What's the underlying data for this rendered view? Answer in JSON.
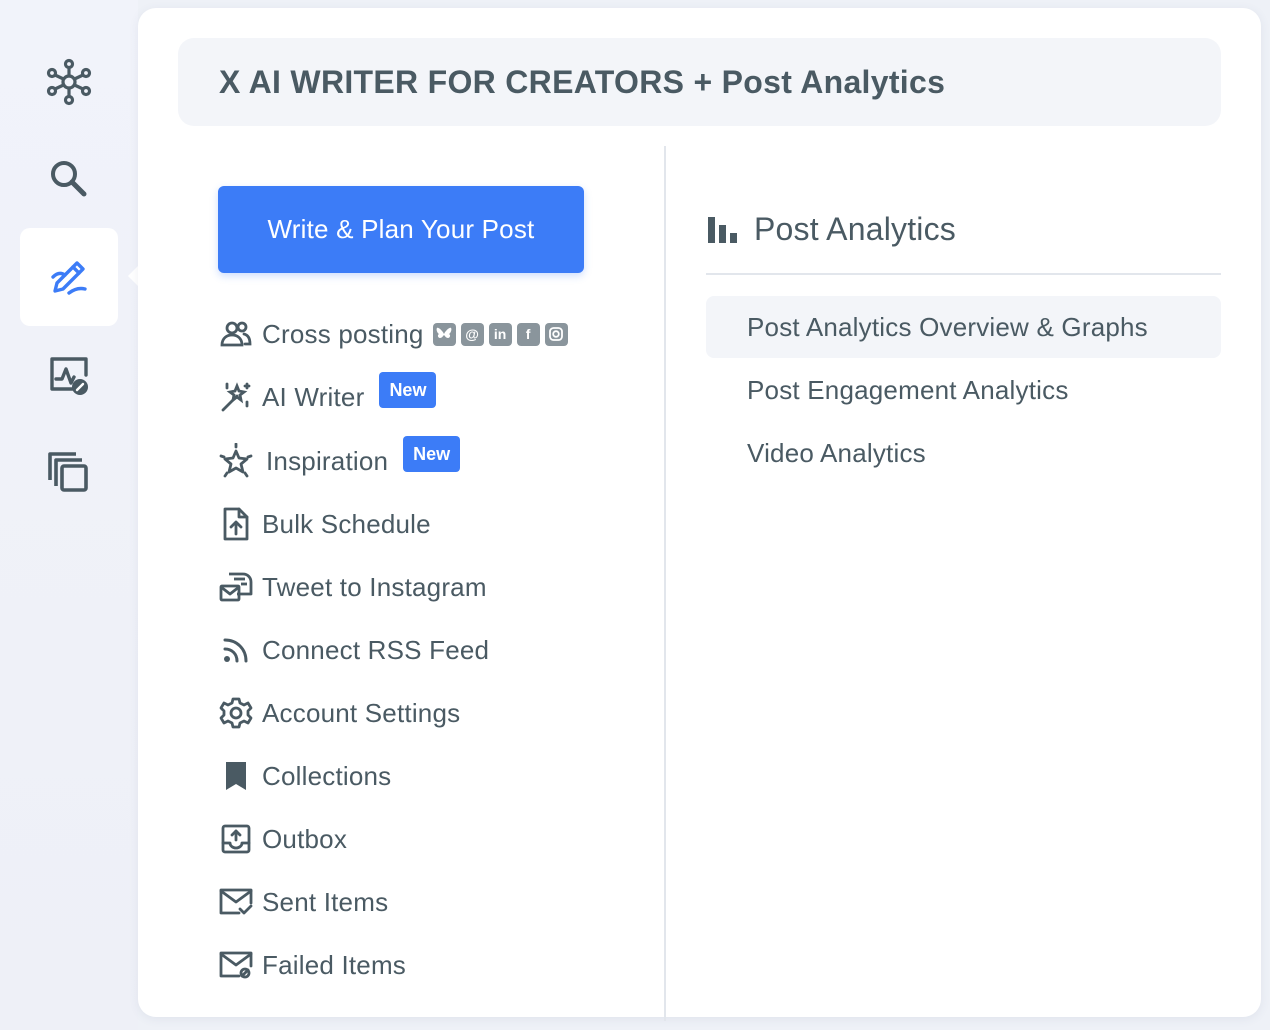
{
  "rail": {
    "items": [
      {
        "icon": "hub-network-icon",
        "active": false
      },
      {
        "icon": "search-icon",
        "active": false
      },
      {
        "icon": "write-edit-icon",
        "active": true
      },
      {
        "icon": "analytics-check-icon",
        "active": false
      },
      {
        "icon": "copy-stack-icon",
        "active": false
      }
    ]
  },
  "panel": {
    "title": "X AI WRITER FOR CREATORS + Post Analytics"
  },
  "left": {
    "cta_label": "Write & Plan Your Post",
    "items": [
      {
        "label": "Cross posting",
        "icon": "users-icon"
      },
      {
        "label": "AI Writer",
        "icon": "magic-wand-icon",
        "badge": "New"
      },
      {
        "label": "Inspiration",
        "icon": "sparkle-star-icon",
        "badge": "New"
      },
      {
        "label": "Bulk Schedule",
        "icon": "file-upload-icon"
      },
      {
        "label": "Tweet to Instagram",
        "icon": "mailbox-icon"
      },
      {
        "label": "Connect RSS Feed",
        "icon": "rss-icon"
      },
      {
        "label": "Account Settings",
        "icon": "gear-icon"
      },
      {
        "label": "Collections",
        "icon": "bookmark-icon"
      },
      {
        "label": "Outbox",
        "icon": "outbox-icon"
      },
      {
        "label": "Sent Items",
        "icon": "mail-check-icon"
      },
      {
        "label": "Failed Items",
        "icon": "mail-failed-icon"
      }
    ],
    "socials": [
      {
        "name": "bluesky-icon",
        "glyph": "🦋"
      },
      {
        "name": "threads-icon",
        "glyph": "@"
      },
      {
        "name": "linkedin-icon",
        "glyph": "in"
      },
      {
        "name": "facebook-icon",
        "glyph": "f"
      },
      {
        "name": "instagram-icon",
        "glyph": "◎"
      }
    ]
  },
  "right": {
    "header": "Post Analytics",
    "items": [
      {
        "label": "Post Analytics Overview & Graphs",
        "active": true
      },
      {
        "label": "Post Engagement Analytics",
        "active": false
      },
      {
        "label": "Video Analytics",
        "active": false
      }
    ]
  },
  "colors": {
    "accent": "#3c7cf7",
    "text": "#4a5a63",
    "rail_bg": "#eef0f7",
    "panel_bg": "#ffffff",
    "header_bg": "#f3f5f9"
  }
}
